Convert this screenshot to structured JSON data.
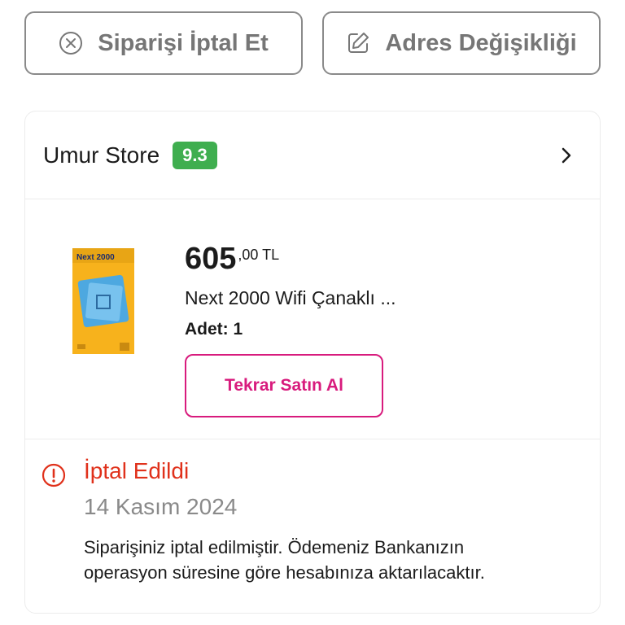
{
  "actions": {
    "cancel_label": "Siparişi İptal Et",
    "address_label": "Adres Değişikliği"
  },
  "store": {
    "name": "Umur Store",
    "rating": "9.3"
  },
  "product": {
    "price_main": "605",
    "price_fraction": ",00 TL",
    "name": "Next 2000 Wifi Çanaklı ...",
    "quantity": "Adet: 1",
    "rebuy_label": "Tekrar Satın Al",
    "image_text": "Next 2000"
  },
  "status": {
    "label": "İptal Edildi",
    "date": "14 Kasım 2024",
    "description": "Siparişiniz iptal edilmiştir. Ödemeniz Bankanızın operasyon süresine göre hesabınıza aktarılacaktır."
  },
  "colors": {
    "accent": "#d81b7d",
    "rating_green": "#3fae4f",
    "cancel_red": "#e0311b",
    "muted_gray": "#8a8a8a"
  },
  "icons": {
    "cancel": "close-circle-icon",
    "address": "edit-icon",
    "store": "chevron-right-icon",
    "status": "alert-circle-icon"
  }
}
